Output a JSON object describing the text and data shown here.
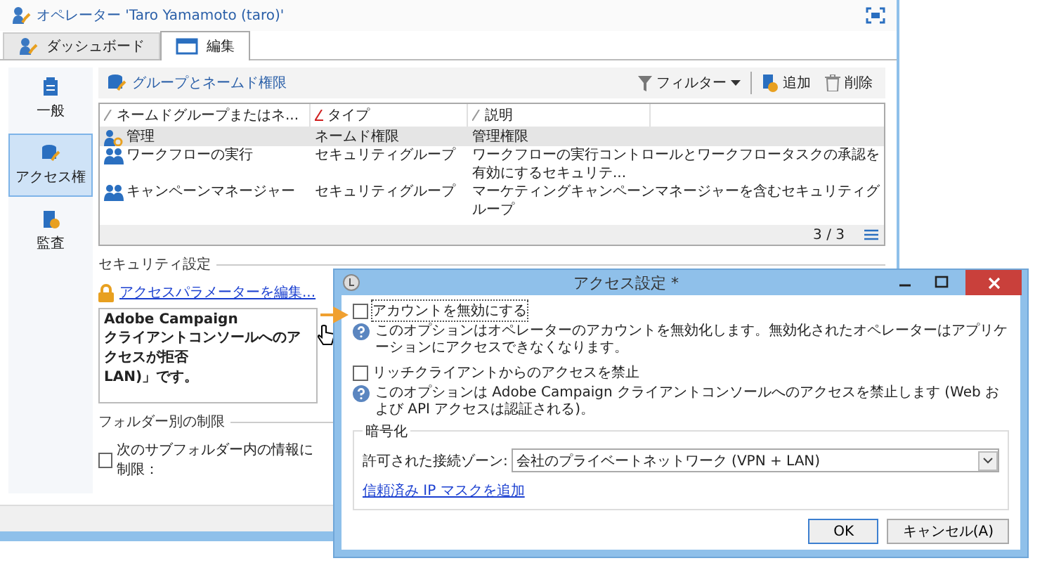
{
  "window": {
    "title": "オペレーター 'Taro Yamamoto (taro)'"
  },
  "tabs": [
    {
      "label": "ダッシュボード",
      "selected": false,
      "kind": "dashboard"
    },
    {
      "label": "編集",
      "selected": true,
      "kind": "edit"
    }
  ],
  "sidebar": {
    "items": [
      {
        "label": "一般",
        "selected": false,
        "kind": "general"
      },
      {
        "label": "アクセス権",
        "selected": true,
        "kind": "access"
      },
      {
        "label": "監査",
        "selected": false,
        "kind": "audit"
      }
    ]
  },
  "toolbar": {
    "title": "グループとネームド権限",
    "filter": "フィルター",
    "add": "追加",
    "delete": "削除"
  },
  "table": {
    "columns": [
      {
        "label": "ネームドグループまたはネ...",
        "sorted": false
      },
      {
        "label": "タイプ",
        "sorted": true
      },
      {
        "label": "説明",
        "sorted": false
      }
    ],
    "rows": [
      {
        "kind": "right",
        "selected": true,
        "cells": [
          "管理",
          "ネームド権限",
          "管理権限"
        ]
      },
      {
        "kind": "group",
        "selected": false,
        "cells": [
          "ワークフローの実行",
          "セキュリティグループ",
          "ワークフローの実行コントロールとワークフロータスクの承認を有効にするセキュリテ..."
        ]
      },
      {
        "kind": "group",
        "selected": false,
        "cells": [
          "キャンペーンマネージャー",
          "セキュリティグループ",
          "マーケティングキャンペーンマネージャーを含むセキュリティグループ"
        ]
      }
    ],
    "pager": "3 / 3"
  },
  "security": {
    "heading": "セキュリティ設定",
    "link": "アクセスパラメーターを編集...",
    "description": [
      "Adobe Campaign",
      "クライアントコンソールへのアクセスが拒否",
      "LAN)」です。"
    ]
  },
  "folder": {
    "heading": "フォルダー別の制限",
    "checkbox": {
      "label": "次のサブフォルダー内の情報に制限：",
      "checked": false
    }
  },
  "dialog": {
    "title": "アクセス設定 *",
    "options": [
      {
        "label": "アカウントを無効にする",
        "checked": false,
        "help": "このオプションはオペレーターのアカウントを無効化します。無効化されたオペレーターはアプリケーションにアクセスできなくなります。"
      },
      {
        "label": "リッチクライアントからのアクセスを禁止",
        "checked": false,
        "help": "このオプションは Adobe Campaign クライアントコンソールへのアクセスを禁止します (Web および API アクセスは認証される)。"
      }
    ],
    "encryption": {
      "heading": "暗号化",
      "zone_label": "許可された接続ゾーン:",
      "zone_value": "会社のプライベートネットワーク (VPN + LAN)",
      "link": "信頼済み IP マスクを追加"
    },
    "buttons": [
      {
        "label": "OK",
        "kind": "primary"
      },
      {
        "label": "キャンセル(A)",
        "kind": "cancel"
      }
    ]
  }
}
